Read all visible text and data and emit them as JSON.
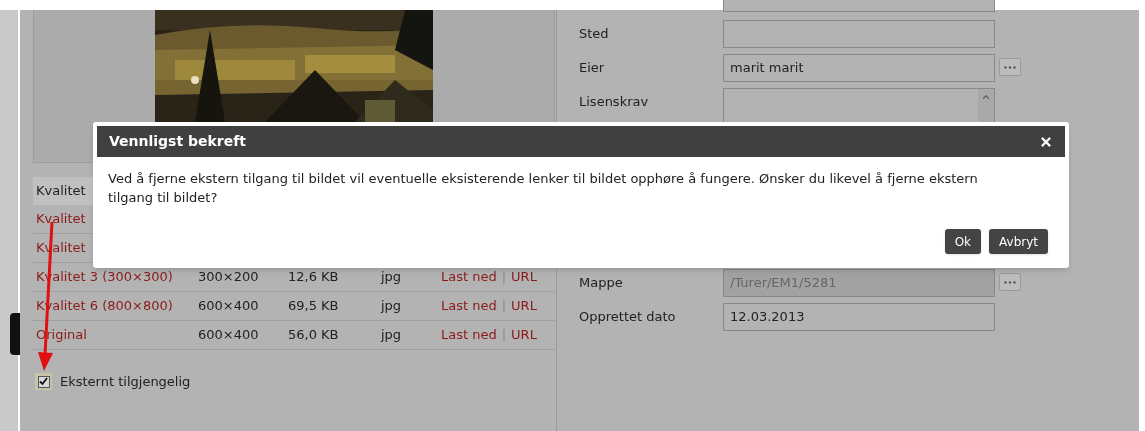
{
  "quality_table": {
    "header": [
      "Kvalitet"
    ],
    "rows": [
      {
        "name": "Kvalitet"
      },
      {
        "name": "Kvalitet"
      },
      {
        "name": "Kvalitet 3 (300×300)",
        "dimensions": "300×200",
        "size": "12,6 KB",
        "format": "jpg",
        "download": "Last ned",
        "separator": "|",
        "url": "URL"
      },
      {
        "name": "Kvalitet 6 (800×800)",
        "dimensions": "600×400",
        "size": "69,5 KB",
        "format": "jpg",
        "download": "Last ned",
        "separator": "|",
        "url": "URL"
      },
      {
        "name": "Original",
        "dimensions": "600×400",
        "size": "56,0 KB",
        "format": "jpg",
        "download": "Last ned",
        "separator": "|",
        "url": "URL"
      }
    ]
  },
  "external_access": {
    "label": "Eksternt tilgjengelig",
    "checked": true
  },
  "fields": [
    {
      "kind": "text",
      "label": "Sted",
      "disabled": false,
      "picker": false
    },
    {
      "kind": "text",
      "label": "Eier",
      "value": "marit marit",
      "disabled": false,
      "picker": true
    },
    {
      "kind": "textarea",
      "label": "Lisenskrav",
      "disabled": false,
      "picker": false
    },
    {
      "kind": "text",
      "label": "Mappe",
      "value": "/Turer/EM1/5281",
      "disabled": true,
      "picker": true
    },
    {
      "kind": "text",
      "label": "Opprettet dato",
      "value": "12.03.2013",
      "disabled": false,
      "picker": false
    }
  ],
  "dialog": {
    "title": "Vennligst bekreft",
    "message": "Ved å fjerne ekstern tilgang til bildet vil eventuelle eksisterende lenker til bildet opphøre å fungere. Ønsker du likevel å fjerne ekstern tilgang til bildet?",
    "buttons": [
      "Ok",
      "Avbryt"
    ]
  }
}
